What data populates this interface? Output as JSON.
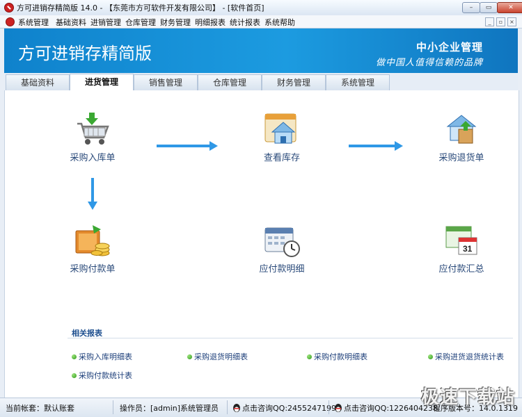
{
  "window": {
    "title": "方可进销存精简版 14.0 - 【东莞市方可软件开发有限公司】 - [软件首页]",
    "minimize": "–",
    "restore": "▭",
    "close": "✕"
  },
  "menubar": {
    "items": [
      "系统管理",
      "基础资料",
      "进销管理",
      "仓库管理",
      "财务管理",
      "明细报表",
      "统计报表",
      "系统帮助"
    ],
    "mdi": [
      "_",
      "▫",
      "×"
    ]
  },
  "banner": {
    "title": "方可进销存精简版",
    "sub1": "中小企业管理",
    "sub2": "做中国人值得信赖的品牌"
  },
  "tabs": [
    "基础资料",
    "进货管理",
    "销售管理",
    "仓库管理",
    "财务管理",
    "系统管理"
  ],
  "active_tab": "进货管理",
  "functions": {
    "purchase_in": "采购入库单",
    "view_stock": "查看库存",
    "purchase_return": "采购退货单",
    "purchase_payment": "采购付款单",
    "payable_detail": "应付款明细",
    "payable_summary": "应付款汇总"
  },
  "related": {
    "title": "相关报表",
    "reports": [
      "采购入库明细表",
      "采购退货明细表",
      "采购付款明细表",
      "采购进货退货统计表",
      "采购付款统计表"
    ]
  },
  "status": {
    "account": "当前帐套：默认账套",
    "operator": "操作员：[admin]系统管理员",
    "qq1": "点击咨询QQ:2455247199",
    "qq2": "点击咨询QQ:1226404238",
    "version": "程序版本号：14.0.1319"
  },
  "watermark": "极速下载站",
  "colors": {
    "banner": "#1c9be0",
    "arrow": "#2f98e6",
    "link": "#1d3f7a"
  }
}
